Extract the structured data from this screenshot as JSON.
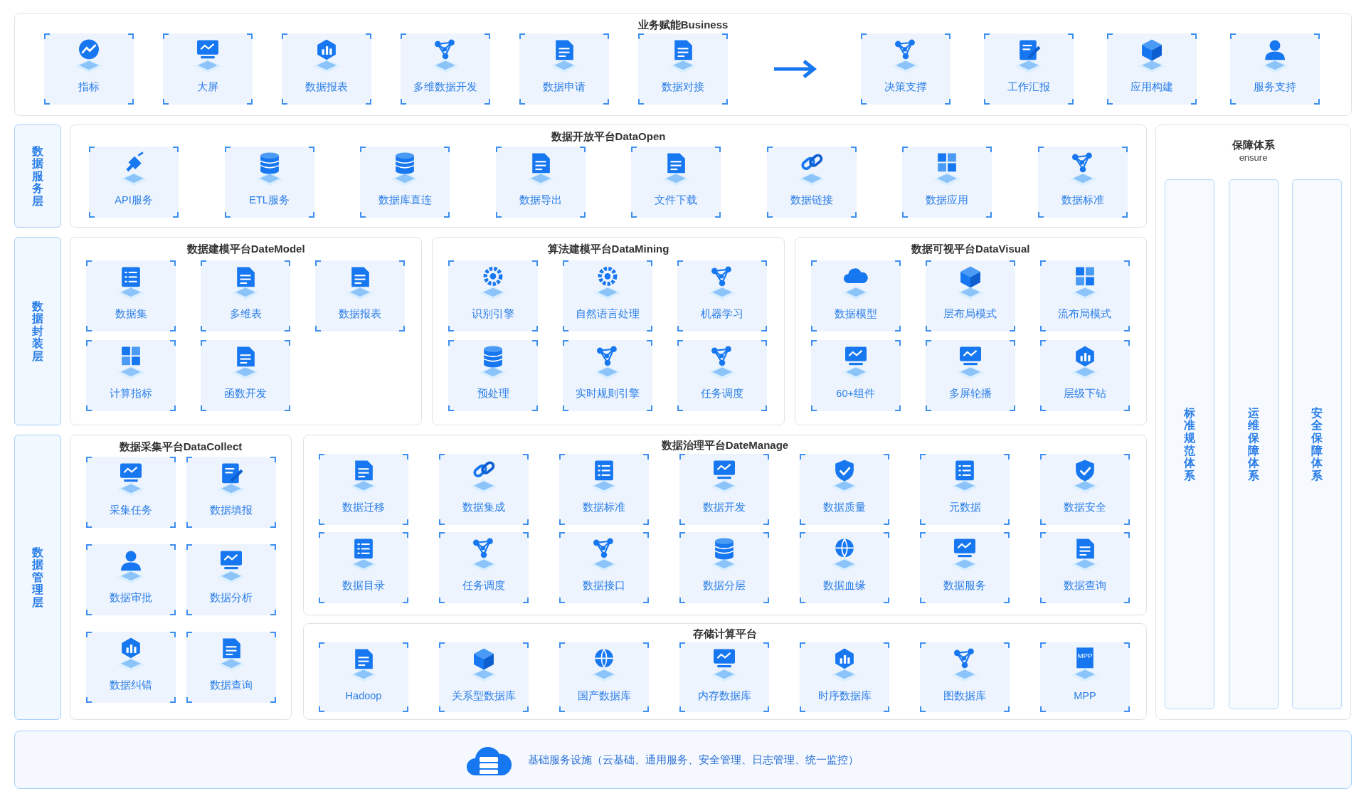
{
  "business": {
    "title": "业务赋能Business",
    "inputs": [
      {
        "label": "指标"
      },
      {
        "label": "大屏"
      },
      {
        "label": "数据报表"
      },
      {
        "label": "多维数据开发"
      },
      {
        "label": "数据申请"
      },
      {
        "label": "数据对接"
      }
    ],
    "outputs": [
      {
        "label": "决策支撑"
      },
      {
        "label": "工作汇报"
      },
      {
        "label": "应用构建"
      },
      {
        "label": "服务支持"
      }
    ]
  },
  "service_layer": {
    "label": "数据服务层",
    "platforms": [
      {
        "title": "数据开放平台DataOpen",
        "items": [
          {
            "label": "API服务"
          },
          {
            "label": "ETL服务"
          },
          {
            "label": "数据库直连"
          },
          {
            "label": "数据导出"
          },
          {
            "label": "文件下载"
          },
          {
            "label": "数据链接"
          },
          {
            "label": "数据应用"
          },
          {
            "label": "数据标准"
          }
        ]
      }
    ]
  },
  "packaging_layer": {
    "label": "数据封装层",
    "platforms": [
      {
        "title": "数据建模平台DateModel",
        "items": [
          {
            "label": "数据集"
          },
          {
            "label": "多维表"
          },
          {
            "label": "数据报表"
          },
          {
            "label": "计算指标"
          },
          {
            "label": "函数开发"
          }
        ]
      },
      {
        "title": "算法建模平台DataMining",
        "items": [
          {
            "label": "识别引擎"
          },
          {
            "label": "自然语言处理"
          },
          {
            "label": "机器学习"
          },
          {
            "label": "预处理"
          },
          {
            "label": "实时规则引擎"
          },
          {
            "label": "任务调度"
          }
        ]
      },
      {
        "title": "数据可视平台DataVisual",
        "items": [
          {
            "label": "数据模型"
          },
          {
            "label": "层布局模式"
          },
          {
            "label": "流布局模式"
          },
          {
            "label": "60+组件"
          },
          {
            "label": "多屏轮播"
          },
          {
            "label": "层级下钻"
          }
        ]
      }
    ]
  },
  "management_layer": {
    "label": "数据管理层",
    "platforms": [
      {
        "title": "数据采集平台DataCollect",
        "items": [
          {
            "label": "采集任务"
          },
          {
            "label": "数据填报"
          },
          {
            "label": "数据审批"
          },
          {
            "label": "数据分析"
          },
          {
            "label": "数据纠错"
          },
          {
            "label": "数据查询"
          }
        ]
      },
      {
        "title": "数据治理平台DateManage",
        "items": [
          {
            "label": "数据迁移"
          },
          {
            "label": "数据集成"
          },
          {
            "label": "数据标准"
          },
          {
            "label": "数据开发"
          },
          {
            "label": "数据质量"
          },
          {
            "label": "元数据"
          },
          {
            "label": "数据安全"
          },
          {
            "label": "数据目录"
          },
          {
            "label": "任务调度"
          },
          {
            "label": "数据接口"
          },
          {
            "label": "数据分层"
          },
          {
            "label": "数据血缘"
          },
          {
            "label": "数据服务"
          },
          {
            "label": "数据查询"
          }
        ]
      },
      {
        "title": "存储计算平台",
        "items": [
          {
            "label": "Hadoop"
          },
          {
            "label": "关系型数据库"
          },
          {
            "label": "国产数据库"
          },
          {
            "label": "内存数据库"
          },
          {
            "label": "时序数据库"
          },
          {
            "label": "图数据库"
          },
          {
            "label": "MPP",
            "icon_text": "MPP"
          }
        ]
      }
    ]
  },
  "guarantee": {
    "title": "保障体系",
    "subtitle": "ensure",
    "columns": [
      "标准规范体系",
      "运维保障体系",
      "安全保障体系"
    ]
  },
  "infrastructure": {
    "text": "基础服务设施（云基础、通用服务、安全管理、日志管理、统一监控）"
  }
}
